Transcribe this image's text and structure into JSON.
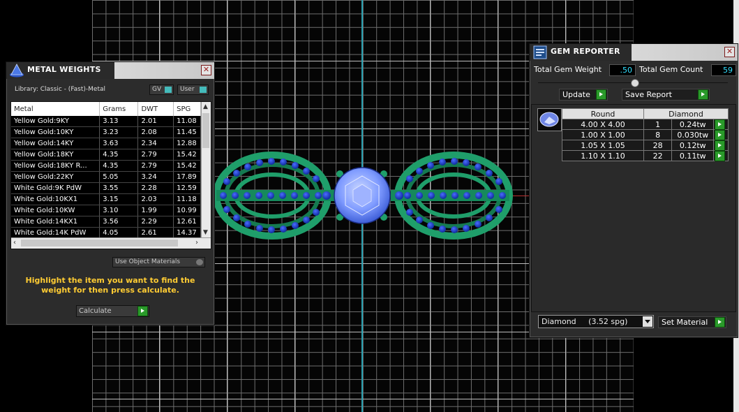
{
  "metal_weights": {
    "title": "METAL WEIGHTS",
    "library": "Library: Classic - (Fast)-Metal",
    "gv_label": "GV",
    "user_label": "User",
    "columns": [
      "Metal",
      "Grams",
      "DWT",
      "SPG"
    ],
    "rows": [
      [
        "Yellow Gold:9KY",
        "3.13",
        "2.01",
        "11.08"
      ],
      [
        "Yellow Gold:10KY",
        "3.23",
        "2.08",
        "11.45"
      ],
      [
        "Yellow Gold:14KY",
        "3.63",
        "2.34",
        "12.88"
      ],
      [
        "Yellow Gold:18KY",
        "4.35",
        "2.79",
        "15.42"
      ],
      [
        "Yellow Gold:18KY R...",
        "4.35",
        "2.79",
        "15.42"
      ],
      [
        "Yellow Gold:22KY",
        "5.05",
        "3.24",
        "17.89"
      ],
      [
        "White Gold:9K PdW",
        "3.55",
        "2.28",
        "12.59"
      ],
      [
        "White Gold:10KX1",
        "3.15",
        "2.03",
        "11.18"
      ],
      [
        "White Gold:10KW",
        "3.10",
        "1.99",
        "10.99"
      ],
      [
        "White Gold:14KX1",
        "3.56",
        "2.29",
        "12.61"
      ],
      [
        "White Gold:14K PdW",
        "4.05",
        "2.61",
        "14.37"
      ]
    ],
    "use_object_materials": "Use Object Materials",
    "hint": "Highlight the item you want to find the weight for then press calculate.",
    "calculate_label": "Calculate"
  },
  "gem_reporter": {
    "title": "GEM REPORTER",
    "total_gem_weight_label": "Total Gem Weight",
    "total_gem_weight": ".50",
    "total_gem_count_label": "Total Gem Count",
    "total_gem_count": "59",
    "update_label": "Update",
    "save_report_label": "Save Report",
    "table_headers": [
      "Round",
      "Diamond"
    ],
    "rows": [
      [
        "4.00 X 4.00",
        "1",
        "0.24tw"
      ],
      [
        "1.00 X 1.00",
        "8",
        "0.030tw"
      ],
      [
        "1.05 X 1.05",
        "28",
        "0.12tw"
      ],
      [
        "1.10 X 1.10",
        "22",
        "0.11tw"
      ]
    ],
    "material_select": "Diamond     (3.52 spg)",
    "set_material_label": "Set Material"
  },
  "colors": {
    "accent_cyan": "#33e0ff",
    "hint_yellow": "#ffcc33",
    "ring_green": "#1f9e6a",
    "gem_blue": "#1b3fb8",
    "button_green": "#2a9a2a"
  }
}
